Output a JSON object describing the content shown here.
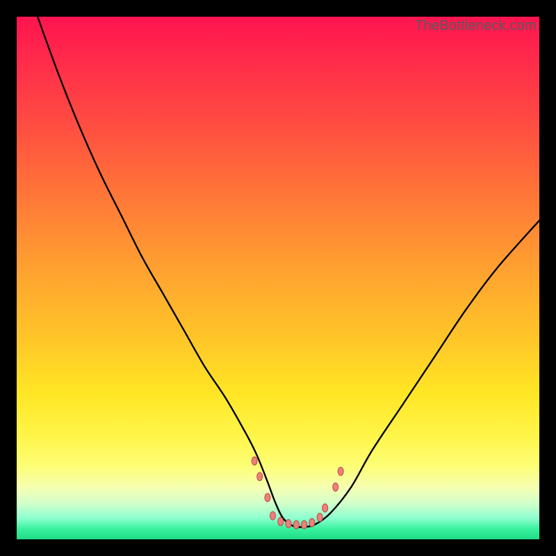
{
  "watermark": "TheBottleneck.com",
  "chart_data": {
    "type": "line",
    "title": "",
    "xlabel": "",
    "ylabel": "",
    "xlim": [
      0,
      100
    ],
    "ylim": [
      0,
      100
    ],
    "series": [
      {
        "name": "main-curve",
        "x": [
          4,
          8,
          12,
          16,
          20,
          24,
          28,
          32,
          36,
          40,
          44,
          46,
          48,
          49.5,
          51,
          53,
          55,
          57,
          60,
          64,
          68,
          74,
          80,
          86,
          92,
          100
        ],
        "y": [
          100,
          89,
          79,
          70,
          62,
          54,
          47,
          40,
          33,
          27,
          20,
          16,
          11,
          7,
          4,
          2.5,
          2.4,
          2.8,
          5,
          10,
          17,
          26,
          35,
          44,
          52,
          61
        ]
      }
    ],
    "markers": [
      {
        "name": "left-high",
        "x": 45.5,
        "y": 15
      },
      {
        "name": "left-mid",
        "x": 46.5,
        "y": 12
      },
      {
        "name": "left-low",
        "x": 48,
        "y": 8
      },
      {
        "name": "bottom-1",
        "x": 49,
        "y": 4.5
      },
      {
        "name": "bottom-2",
        "x": 50.5,
        "y": 3.4
      },
      {
        "name": "bottom-3",
        "x": 52,
        "y": 3.0
      },
      {
        "name": "bottom-4",
        "x": 53.5,
        "y": 2.8
      },
      {
        "name": "bottom-5",
        "x": 55,
        "y": 2.8
      },
      {
        "name": "bottom-6",
        "x": 56.5,
        "y": 3.2
      },
      {
        "name": "bottom-7",
        "x": 58,
        "y": 4.2
      },
      {
        "name": "right-low",
        "x": 59,
        "y": 6
      },
      {
        "name": "right-mid",
        "x": 61,
        "y": 10
      },
      {
        "name": "right-high",
        "x": 62,
        "y": 13
      }
    ],
    "marker_style": {
      "fill": "#ef7f7a",
      "stroke": "#b64c47",
      "rx": 4,
      "ry": 6
    }
  }
}
